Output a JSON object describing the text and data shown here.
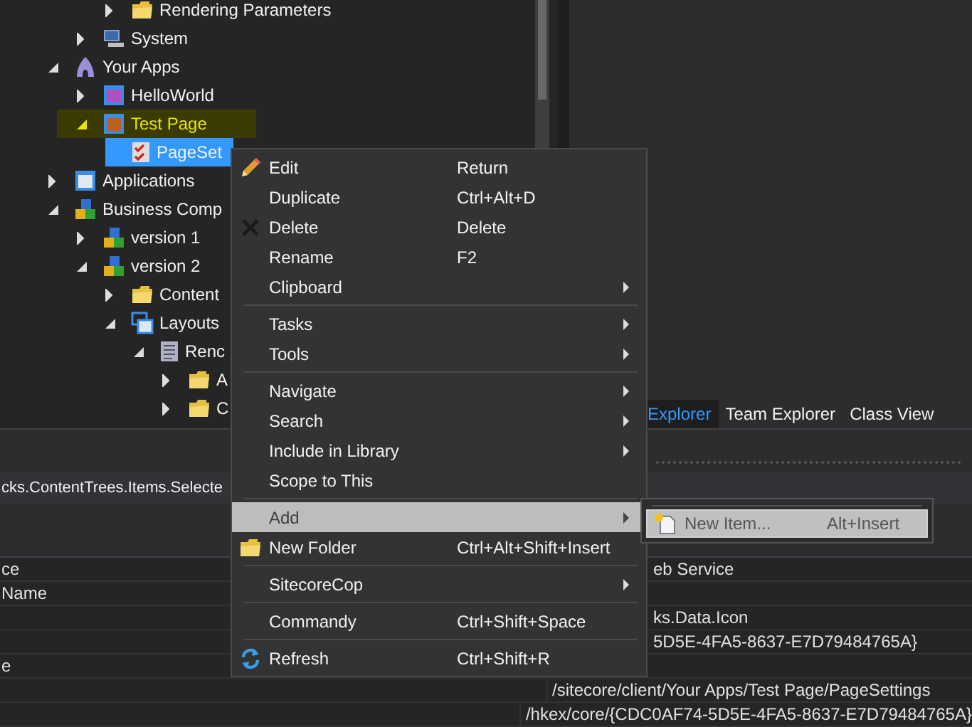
{
  "tree": {
    "items": [
      {
        "children": [
          {
            "children": [
              {
                "label": "Rendering Parameters",
                "kind": "folder",
                "expanded": false,
                "selected": false,
                "highlighted": false
              }
            ]
          },
          {
            "label": "System",
            "kind": "system",
            "expanded": false,
            "selected": false,
            "highlighted": false
          }
        ]
      },
      {
        "label": "Your Apps",
        "kind": "apps",
        "expanded": true,
        "selected": false,
        "highlighted": false,
        "children": [
          {
            "label": "HelloWorld",
            "kind": "window",
            "expanded": false,
            "selected": false,
            "highlighted": false
          },
          {
            "label": "Test Page",
            "kind": "page",
            "expanded": true,
            "selected": false,
            "highlighted": true,
            "children": [
              {
                "label": "PageSet",
                "kind": "checklist",
                "selected": true,
                "highlighted": false
              }
            ]
          }
        ]
      },
      {
        "label": "Applications",
        "kind": "applications",
        "expanded": false,
        "selected": false,
        "highlighted": false
      },
      {
        "label": "Business Comp",
        "kind": "components",
        "expanded": true,
        "selected": false,
        "highlighted": false,
        "children": [
          {
            "label": "version 1",
            "kind": "components",
            "expanded": false,
            "selected": false,
            "highlighted": false
          },
          {
            "label": "version 2",
            "kind": "components",
            "expanded": true,
            "selected": false,
            "highlighted": false,
            "children": [
              {
                "label": "Content",
                "kind": "folder",
                "expanded": false,
                "selected": false,
                "highlighted": false
              },
              {
                "label": "Layouts",
                "kind": "layouts",
                "expanded": true,
                "selected": false,
                "highlighted": false,
                "children": [
                  {
                    "label": "Renc",
                    "kind": "document",
                    "expanded": true,
                    "selected": false,
                    "highlighted": false,
                    "children": [
                      {
                        "label": "A",
                        "kind": "folder",
                        "expanded": false,
                        "selected": false,
                        "highlighted": false
                      },
                      {
                        "label": "C",
                        "kind": "folder",
                        "expanded": false,
                        "selected": false,
                        "highlighted": false
                      }
                    ]
                  }
                ]
              }
            ]
          }
        ]
      }
    ]
  },
  "tabs": [
    {
      "label": "Explorer",
      "selected": true
    },
    {
      "label": "Team Explorer",
      "selected": false
    },
    {
      "label": "Class View",
      "selected": false
    }
  ],
  "properties": {
    "object": "cks.ContentTrees.Items.Selecte",
    "rows": [
      {
        "kind": "clipped",
        "name": "ce",
        "value": "eb Service"
      },
      {
        "kind": "clipped",
        "name": "Name"
      },
      {
        "kind": "clipped",
        "value": "ks.Data.Icon"
      },
      {
        "kind": "clipped",
        "value": "5D5E-4FA5-8637-E7D79484765A}"
      },
      {
        "kind": "clipped",
        "name": "e"
      },
      {
        "kind": "full",
        "value": "/sitecore/client/Your Apps/Test Page/PageSettings"
      },
      {
        "kind": "full",
        "value": "/hkex/core/{CDC0AF74-5D5E-4FA5-8637-E7D79484765A}"
      }
    ]
  },
  "context_menu": {
    "items": [
      {
        "kind": "pencil",
        "label": "Edit",
        "shortcut": "Return",
        "submenu": false,
        "selected": false
      },
      {
        "kind": "item",
        "label": "Duplicate",
        "shortcut": "Ctrl+Alt+D",
        "submenu": false,
        "selected": false
      },
      {
        "kind": "cross",
        "label": "Delete",
        "shortcut": "Delete",
        "submenu": false,
        "selected": false
      },
      {
        "kind": "item",
        "label": "Rename",
        "shortcut": "F2",
        "submenu": false,
        "selected": false
      },
      {
        "kind": "item",
        "label": "Clipboard",
        "submenu": true,
        "selected": false
      },
      {
        "kind": "separator"
      },
      {
        "kind": "item",
        "label": "Tasks",
        "submenu": true,
        "selected": false
      },
      {
        "kind": "item",
        "label": "Tools",
        "submenu": true,
        "selected": false
      },
      {
        "kind": "separator"
      },
      {
        "kind": "item",
        "label": "Navigate",
        "submenu": true,
        "selected": false
      },
      {
        "kind": "item",
        "label": "Search",
        "submenu": true,
        "selected": false
      },
      {
        "kind": "item",
        "label": "Include in Library",
        "submenu": true,
        "selected": false
      },
      {
        "kind": "item",
        "label": "Scope to This",
        "submenu": false,
        "selected": false
      },
      {
        "kind": "separator"
      },
      {
        "kind": "item",
        "label": "Add",
        "submenu": true,
        "selected": true
      },
      {
        "kind": "folder",
        "label": "New Folder",
        "shortcut": "Ctrl+Alt+Shift+Insert",
        "submenu": false,
        "selected": false
      },
      {
        "kind": "separator"
      },
      {
        "kind": "item",
        "label": "SitecoreCop",
        "submenu": true,
        "selected": false
      },
      {
        "kind": "separator"
      },
      {
        "kind": "item",
        "label": "Commandy",
        "shortcut": "Ctrl+Shift+Space",
        "submenu": false,
        "selected": false
      },
      {
        "kind": "separator"
      },
      {
        "kind": "refresh",
        "label": "Refresh",
        "shortcut": "Ctrl+Shift+R",
        "submenu": false,
        "selected": false
      }
    ]
  },
  "submenu": {
    "items": [
      {
        "label": "New Item...",
        "shortcut": "Alt+Insert",
        "selected": true
      }
    ]
  }
}
